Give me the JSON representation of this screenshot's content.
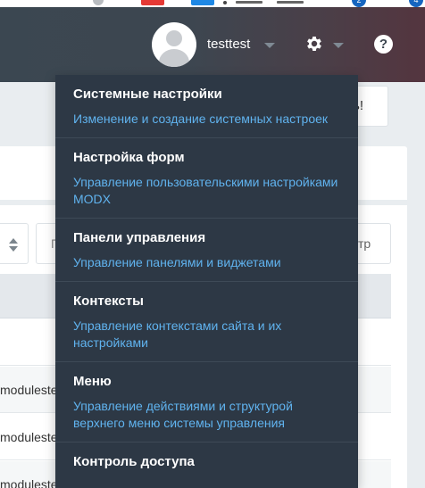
{
  "browser": {
    "badges": [
      "2",
      "4"
    ]
  },
  "header": {
    "username": "testtest",
    "help_label": "?"
  },
  "background": {
    "alert_fragment": "ь!",
    "search_fragment": "П",
    "filter_fragment": "тр",
    "rows": [
      "modulestest",
      "modulestest",
      "modulestest"
    ]
  },
  "menu": {
    "items": [
      {
        "title": "Системные настройки",
        "description": "Изменение и создание системных настроек"
      },
      {
        "title": "Настройка форм",
        "description": "Управление пользовательскими настройками MODX"
      },
      {
        "title": "Панели управления",
        "description": "Управление панелями и виджетами"
      },
      {
        "title": "Контексты",
        "description": "Управление контекстами сайта и их настройками"
      },
      {
        "title": "Меню",
        "description": "Управление действиями и структурой верхнего меню системы управления"
      },
      {
        "title": "Контроль доступа",
        "description": ""
      }
    ]
  },
  "colors": {
    "header_bg": "#3d4650",
    "menu_bg": "#2d3845",
    "menu_link": "#60b3ef",
    "divider": "#3e4a57"
  }
}
